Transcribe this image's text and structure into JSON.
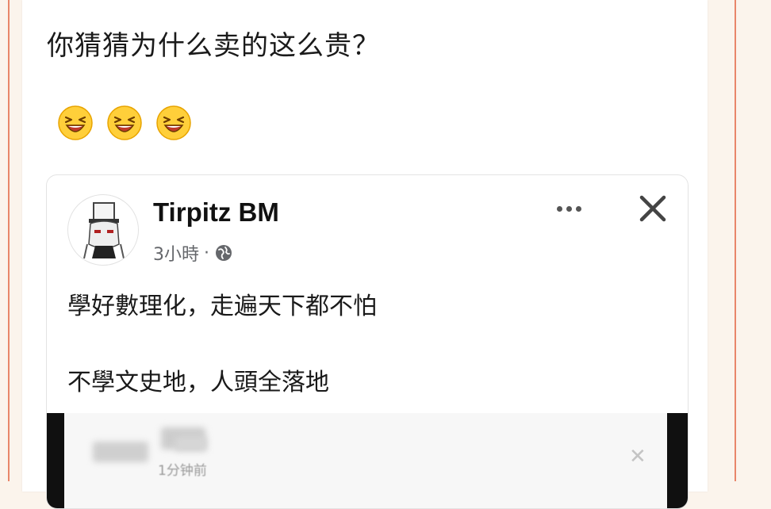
{
  "header": {
    "question": "你猜猜为什么卖的这么贵？",
    "emojis": [
      "grinning-squint-face-icon",
      "grinning-squint-face-icon",
      "grinning-squint-face-icon"
    ]
  },
  "post": {
    "author": "Tirpitz BM",
    "time": "3小時",
    "separator": "·",
    "privacy_icon": "globe-icon",
    "more_icon": "ellipsis-icon",
    "close_icon": "close-icon",
    "lines": [
      "學好數理化，走遍天下都不怕",
      "不學文史地，人頭全落地"
    ]
  },
  "embedded": {
    "time": "1分钟前",
    "close_icon": "close-icon"
  },
  "colors": {
    "frame_border": "#e8866a",
    "background": "#fbf4ec",
    "text": "#1a1a1a",
    "meta_text": "#65676b"
  }
}
